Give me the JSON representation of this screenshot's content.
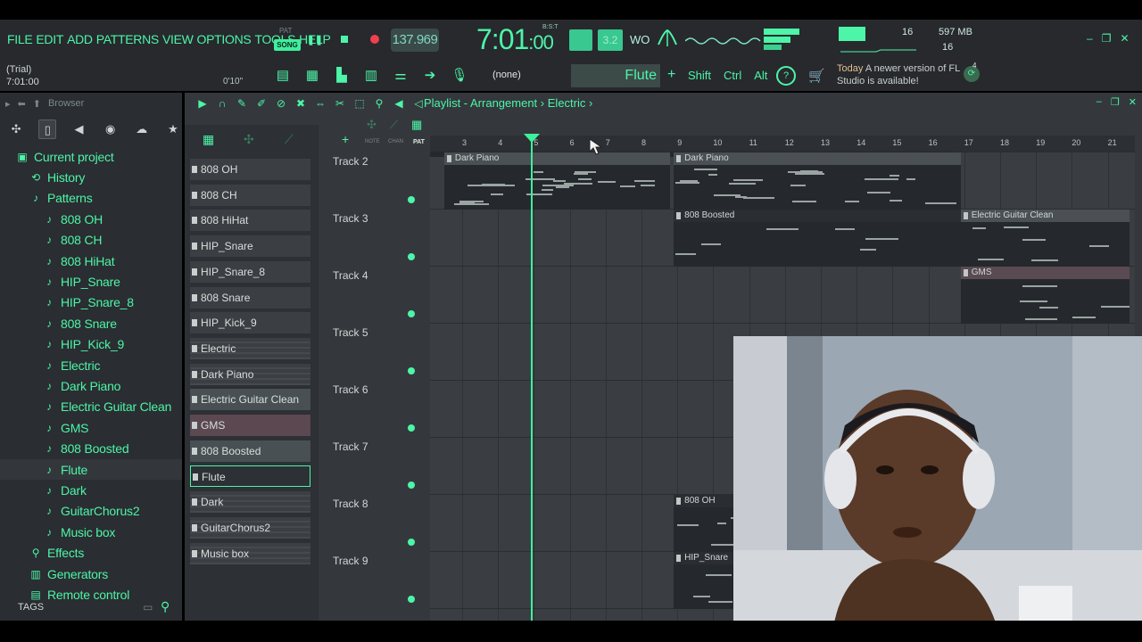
{
  "menu": [
    "FILE",
    "EDIT",
    "ADD",
    "PATTERNS",
    "VIEW",
    "OPTIONS",
    "TOOLS",
    "HELP"
  ],
  "transport": {
    "pat_label": "PAT",
    "song_label": "SONG",
    "tempo": "137.969",
    "time_main": "7:01",
    "time_small": "00",
    "bst_label": "B:S:T",
    "mode2_label": "3.2",
    "wo_label": "WO"
  },
  "status": {
    "cpu_voices": "16",
    "memory": "597 MB",
    "polyphony": "16"
  },
  "hint": {
    "trial": "(Trial)",
    "position": "7:01:00",
    "small_time": "0'10\""
  },
  "toolbar2": {
    "none_label": "(none)",
    "pattern_name": "Flute",
    "shift": "Shift",
    "ctrl": "Ctrl",
    "alt": "Alt"
  },
  "news": {
    "today": "Today",
    "message": "A newer version of FL Studio is available!",
    "badge": "4"
  },
  "browser": {
    "title": "Browser",
    "tags_label": "TAGS",
    "items": [
      {
        "label": "Current project",
        "icon": "project-icon",
        "level": 0,
        "glyph": "▣"
      },
      {
        "label": "History",
        "icon": "history-icon",
        "level": 1,
        "glyph": "⟲"
      },
      {
        "label": "Patterns",
        "icon": "note-icon",
        "level": 1,
        "glyph": "♪"
      },
      {
        "label": "808 OH",
        "icon": "note-icon",
        "level": 2,
        "glyph": "♪"
      },
      {
        "label": "808 CH",
        "icon": "note-icon",
        "level": 2,
        "glyph": "♪"
      },
      {
        "label": "808 HiHat",
        "icon": "note-icon",
        "level": 2,
        "glyph": "♪"
      },
      {
        "label": "HIP_Snare",
        "icon": "note-icon",
        "level": 2,
        "glyph": "♪"
      },
      {
        "label": "HIP_Snare_8",
        "icon": "note-icon",
        "level": 2,
        "glyph": "♪"
      },
      {
        "label": "808 Snare",
        "icon": "note-icon",
        "level": 2,
        "glyph": "♪"
      },
      {
        "label": "HIP_Kick_9",
        "icon": "note-icon",
        "level": 2,
        "glyph": "♪"
      },
      {
        "label": "Electric",
        "icon": "note-icon",
        "level": 2,
        "glyph": "♪"
      },
      {
        "label": "Dark Piano",
        "icon": "note-icon",
        "level": 2,
        "glyph": "♪"
      },
      {
        "label": "Electric Guitar Clean",
        "icon": "note-icon",
        "level": 2,
        "glyph": "♪"
      },
      {
        "label": "GMS",
        "icon": "note-icon",
        "level": 2,
        "glyph": "♪"
      },
      {
        "label": "808 Boosted",
        "icon": "note-icon",
        "level": 2,
        "glyph": "♪"
      },
      {
        "label": "Flute",
        "icon": "note-icon",
        "level": 2,
        "glyph": "♪",
        "selected": true
      },
      {
        "label": "Dark",
        "icon": "note-icon",
        "level": 2,
        "glyph": "♪"
      },
      {
        "label": "GuitarChorus2",
        "icon": "note-icon",
        "level": 2,
        "glyph": "♪"
      },
      {
        "label": "Music box",
        "icon": "note-icon",
        "level": 2,
        "glyph": "♪"
      },
      {
        "label": "Effects",
        "icon": "effects-icon",
        "level": 1,
        "glyph": "⚲"
      },
      {
        "label": "Generators",
        "icon": "generators-icon",
        "level": 1,
        "glyph": "▥"
      },
      {
        "label": "Remote control",
        "icon": "remote-icon",
        "level": 1,
        "glyph": "▤"
      }
    ]
  },
  "playlist": {
    "title": "Playlist - Arrangement",
    "arrow": "›",
    "pattern": "Electric",
    "timeline_labels": [
      "3",
      "4",
      "5",
      "6",
      "7",
      "8",
      "9",
      "10",
      "11",
      "12",
      "13",
      "14",
      "15",
      "16",
      "17",
      "18",
      "19",
      "20",
      "21"
    ],
    "picker_tabs": [
      "NOTE",
      "CHAN",
      "PAT"
    ],
    "picker": [
      {
        "label": "808 OH",
        "style": ""
      },
      {
        "label": "808 CH",
        "style": ""
      },
      {
        "label": "808 HiHat",
        "style": ""
      },
      {
        "label": "HIP_Snare",
        "style": ""
      },
      {
        "label": "HIP_Snare_8",
        "style": ""
      },
      {
        "label": "808 Snare",
        "style": ""
      },
      {
        "label": "HIP_Kick_9",
        "style": ""
      },
      {
        "label": "Electric",
        "style": "striped"
      },
      {
        "label": "Dark Piano",
        "style": "striped"
      },
      {
        "label": "Electric Guitar Clean",
        "style": "egc"
      },
      {
        "label": "GMS",
        "style": "gms"
      },
      {
        "label": "808 Boosted",
        "style": "egc"
      },
      {
        "label": "Flute",
        "style": "flute"
      },
      {
        "label": "Dark",
        "style": "striped"
      },
      {
        "label": "GuitarChorus2",
        "style": "striped"
      },
      {
        "label": "Music box",
        "style": "striped"
      }
    ],
    "tracks": [
      "Track 2",
      "Track 3",
      "Track 4",
      "Track 5",
      "Track 6",
      "Track 7",
      "Track 8",
      "Track 9"
    ],
    "clips": [
      {
        "label": "Dark Piano",
        "track": 0,
        "bar_start": 2.5,
        "bar_end": 8.8,
        "style": "hl"
      },
      {
        "label": "Dark Piano",
        "track": 0,
        "bar_start": 8.9,
        "bar_end": 16.9,
        "style": "hl"
      },
      {
        "label": "808 Boosted",
        "track": 1,
        "bar_start": 8.9,
        "bar_end": 16.9,
        "style": ""
      },
      {
        "label": "Electric Guitar Clean",
        "track": 1,
        "bar_start": 16.9,
        "bar_end": 21.6,
        "style": "hl"
      },
      {
        "label": "GMS",
        "track": 2,
        "bar_start": 16.9,
        "bar_end": 21.6,
        "style": "gms"
      },
      {
        "label": "808 OH",
        "track": 6,
        "bar_start": 8.9,
        "bar_end": 12,
        "style": ""
      },
      {
        "label": "HIP_Snare",
        "track": 7,
        "bar_start": 8.9,
        "bar_end": 12,
        "style": ""
      }
    ],
    "playhead_bar": 7.4
  },
  "window": {
    "minimize": "–",
    "maximize": "❐",
    "close": "✕"
  }
}
